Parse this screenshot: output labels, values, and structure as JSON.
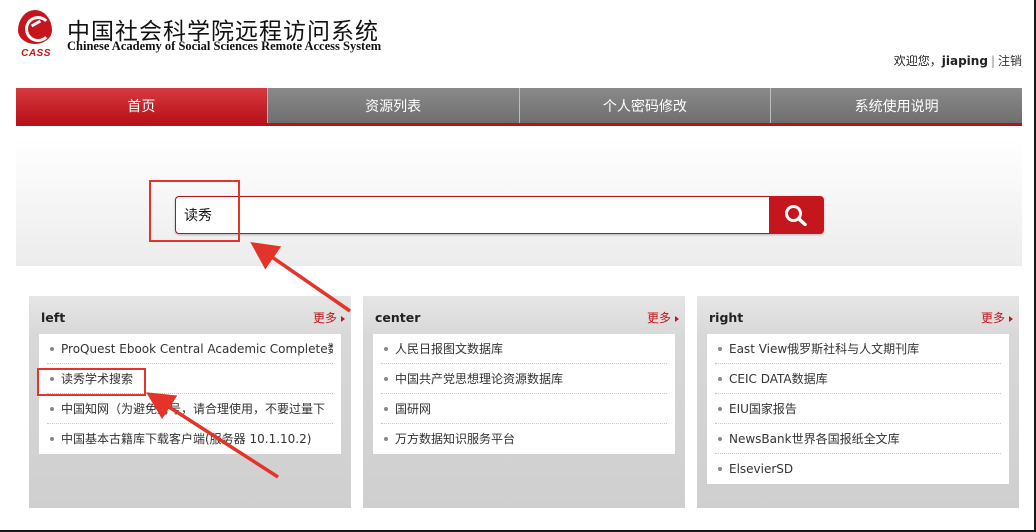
{
  "header": {
    "logo_abbr": "CASS",
    "title_cn": "中国社会科学院远程访问系统",
    "title_en": "Chinese Academy of Social Sciences Remote Access System",
    "welcome_prefix": "欢迎您，",
    "username": "jiaping",
    "separator": "|",
    "logout": "注销"
  },
  "nav": {
    "items": [
      {
        "label": "首页",
        "active": true
      },
      {
        "label": "资源列表",
        "active": false
      },
      {
        "label": "个人密码修改",
        "active": false
      },
      {
        "label": "系统使用说明",
        "active": false
      }
    ]
  },
  "search": {
    "value": "读秀",
    "button_icon": "search-icon"
  },
  "panels": [
    {
      "title": "left",
      "more": "更多",
      "items": [
        "ProQuest Ebook Central Academic Complete数据库",
        "读秀学术搜索",
        "中国知网（为避免封号，请合理使用，不要过量下",
        "中国基本古籍库下载客户端(服务器 10.1.10.2)"
      ]
    },
    {
      "title": "center",
      "more": "更多",
      "items": [
        "人民日报图文数据库",
        "中国共产党思想理论资源数据库",
        "国研网",
        "万方数据知识服务平台"
      ]
    },
    {
      "title": "right",
      "more": "更多",
      "items": [
        "East View俄罗斯社科与人文期刊库",
        "CEIC DATA数据库",
        "EIU国家报告",
        "NewsBank世界各国报纸全文库",
        "ElsevierSD"
      ]
    }
  ],
  "colors": {
    "brand_red": "#c4161c",
    "nav_gray": "#777777",
    "annotation_red": "#e3342a"
  }
}
